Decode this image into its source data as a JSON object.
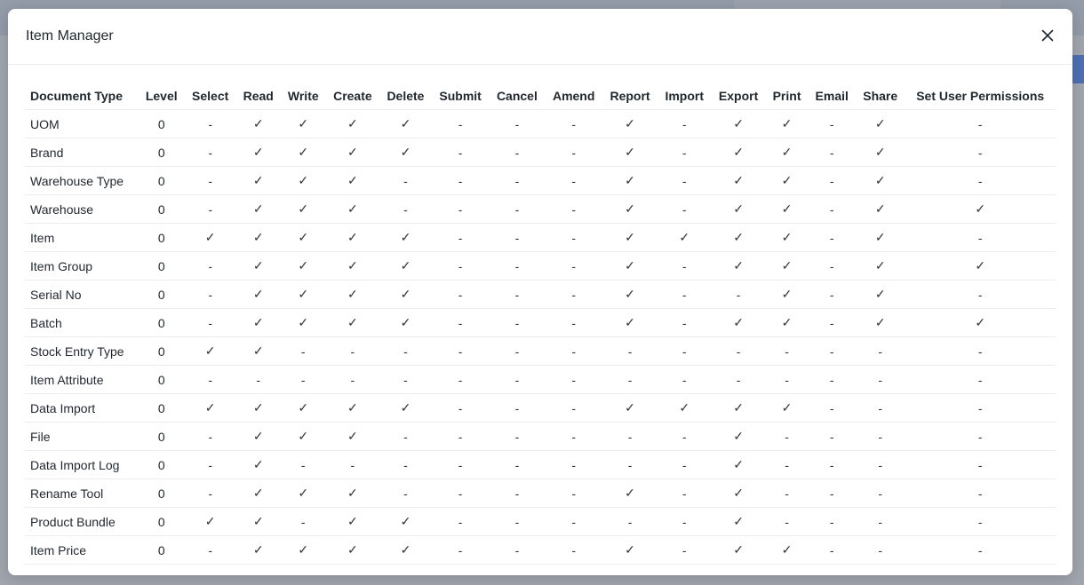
{
  "modal": {
    "title": "Item Manager",
    "close_icon": "close-icon"
  },
  "table": {
    "headers": [
      "Document Type",
      "Level",
      "Select",
      "Read",
      "Write",
      "Create",
      "Delete",
      "Submit",
      "Cancel",
      "Amend",
      "Report",
      "Import",
      "Export",
      "Print",
      "Email",
      "Share",
      "Set User Permissions"
    ],
    "rows": [
      [
        "UOM",
        "0",
        "-",
        "✓",
        "✓",
        "✓",
        "✓",
        "-",
        "-",
        "-",
        "✓",
        "-",
        "✓",
        "✓",
        "-",
        "✓",
        "-"
      ],
      [
        "Brand",
        "0",
        "-",
        "✓",
        "✓",
        "✓",
        "✓",
        "-",
        "-",
        "-",
        "✓",
        "-",
        "✓",
        "✓",
        "-",
        "✓",
        "-"
      ],
      [
        "Warehouse Type",
        "0",
        "-",
        "✓",
        "✓",
        "✓",
        "-",
        "-",
        "-",
        "-",
        "✓",
        "-",
        "✓",
        "✓",
        "-",
        "✓",
        "-"
      ],
      [
        "Warehouse",
        "0",
        "-",
        "✓",
        "✓",
        "✓",
        "-",
        "-",
        "-",
        "-",
        "✓",
        "-",
        "✓",
        "✓",
        "-",
        "✓",
        "✓"
      ],
      [
        "Item",
        "0",
        "✓",
        "✓",
        "✓",
        "✓",
        "✓",
        "-",
        "-",
        "-",
        "✓",
        "✓",
        "✓",
        "✓",
        "-",
        "✓",
        "-"
      ],
      [
        "Item Group",
        "0",
        "-",
        "✓",
        "✓",
        "✓",
        "✓",
        "-",
        "-",
        "-",
        "✓",
        "-",
        "✓",
        "✓",
        "-",
        "✓",
        "✓"
      ],
      [
        "Serial No",
        "0",
        "-",
        "✓",
        "✓",
        "✓",
        "✓",
        "-",
        "-",
        "-",
        "✓",
        "-",
        "-",
        "✓",
        "-",
        "✓",
        "-"
      ],
      [
        "Batch",
        "0",
        "-",
        "✓",
        "✓",
        "✓",
        "✓",
        "-",
        "-",
        "-",
        "✓",
        "-",
        "✓",
        "✓",
        "-",
        "✓",
        "✓"
      ],
      [
        "Stock Entry Type",
        "0",
        "✓",
        "✓",
        "-",
        "-",
        "-",
        "-",
        "-",
        "-",
        "-",
        "-",
        "-",
        "-",
        "-",
        "-",
        "-"
      ],
      [
        "Item Attribute",
        "0",
        "-",
        "-",
        "-",
        "-",
        "-",
        "-",
        "-",
        "-",
        "-",
        "-",
        "-",
        "-",
        "-",
        "-",
        "-"
      ],
      [
        "Data Import",
        "0",
        "✓",
        "✓",
        "✓",
        "✓",
        "✓",
        "-",
        "-",
        "-",
        "✓",
        "✓",
        "✓",
        "✓",
        "-",
        "-",
        "-"
      ],
      [
        "File",
        "0",
        "-",
        "✓",
        "✓",
        "✓",
        "-",
        "-",
        "-",
        "-",
        "-",
        "-",
        "✓",
        "-",
        "-",
        "-",
        "-"
      ],
      [
        "Data Import Log",
        "0",
        "-",
        "✓",
        "-",
        "-",
        "-",
        "-",
        "-",
        "-",
        "-",
        "-",
        "✓",
        "-",
        "-",
        "-",
        "-"
      ],
      [
        "Rename Tool",
        "0",
        "-",
        "✓",
        "✓",
        "✓",
        "-",
        "-",
        "-",
        "-",
        "✓",
        "-",
        "✓",
        "-",
        "-",
        "-",
        "-"
      ],
      [
        "Product Bundle",
        "0",
        "✓",
        "✓",
        "-",
        "✓",
        "✓",
        "-",
        "-",
        "-",
        "-",
        "-",
        "✓",
        "-",
        "-",
        "-",
        "-"
      ],
      [
        "Item Price",
        "0",
        "-",
        "✓",
        "✓",
        "✓",
        "✓",
        "-",
        "-",
        "-",
        "✓",
        "-",
        "✓",
        "✓",
        "-",
        "-",
        "-"
      ]
    ]
  }
}
